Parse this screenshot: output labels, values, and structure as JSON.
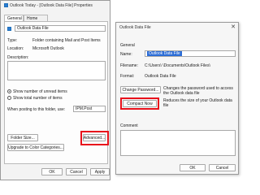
{
  "back_window": {
    "title": "Outlook Today - [Outlook Data File] Properties",
    "tabs": [
      "General",
      "Home Page"
    ],
    "name_value": "Outlook Data File",
    "type_label": "Type:",
    "type_value": "Folder containing Mail and Post Items",
    "location_label": "Location:",
    "location_value": "Microsoft Outlook",
    "description_label": "Description:",
    "radio_unread": "Show number of unread items",
    "radio_total": "Show total number of items",
    "posting_label": "When posting to this folder, use:",
    "posting_value": "IPM.Post",
    "folder_size_btn": "Folder Size...",
    "upgrade_btn": "Upgrade to Color Categories...",
    "advanced_btn": "Advanced...",
    "ok_btn": "OK",
    "cancel_btn": "Cancel",
    "apply_btn": "Apply"
  },
  "front_window": {
    "title": "Outlook Data File",
    "section": "General",
    "name_label": "Name:",
    "name_value": "Outlook Data File",
    "filename_label": "Filename:",
    "filename_value": "C:\\Users\\                \\Documents\\Outlook Files\\",
    "format_label": "Format:",
    "format_value": "Outlook Data File",
    "change_password_btn": "Change Password...",
    "change_password_desc": "Changes the password used to access the Outlook data file",
    "compact_btn": "Compact Now",
    "compact_desc": "Reduces the size of your Outlook data file",
    "comment_label": "Comment",
    "ok_btn": "OK",
    "cancel_btn": "Cancel"
  }
}
